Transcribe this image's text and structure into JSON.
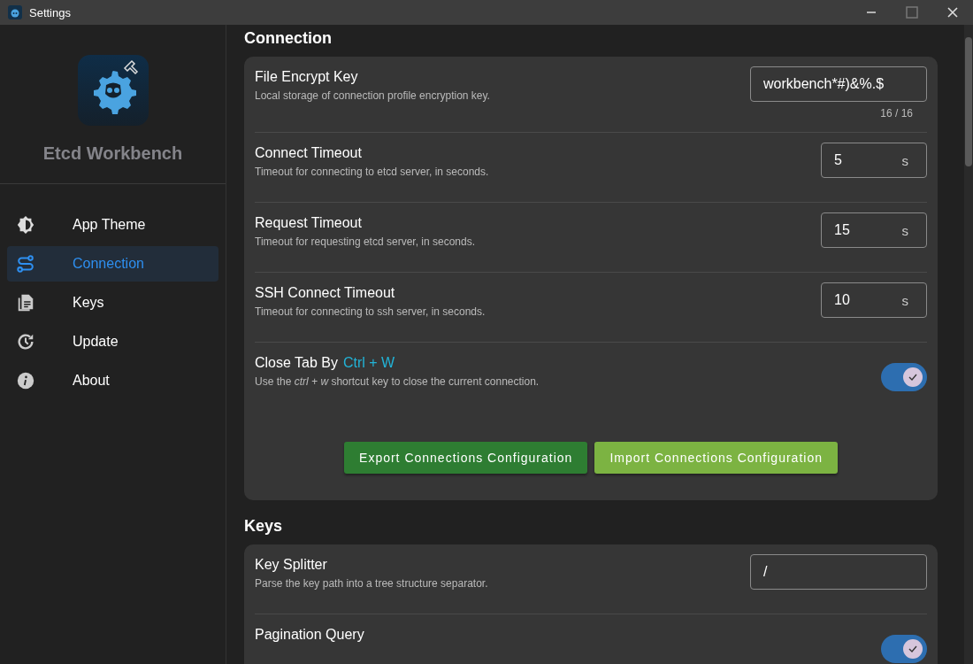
{
  "window": {
    "title": "Settings"
  },
  "app": {
    "name": "Etcd Workbench"
  },
  "sidebar": {
    "items": [
      {
        "kind": "theme",
        "label": "App Theme",
        "selected": false
      },
      {
        "kind": "connection",
        "label": "Connection",
        "selected": true
      },
      {
        "kind": "keys",
        "label": "Keys",
        "selected": false
      },
      {
        "kind": "update",
        "label": "Update",
        "selected": false
      },
      {
        "kind": "about",
        "label": "About",
        "selected": false
      }
    ]
  },
  "sections": [
    {
      "title": "Connection",
      "rows": [
        {
          "kind": "text",
          "label": "File Encrypt Key",
          "description": "Local storage of connection profile encryption key.",
          "value": "workbench*#)&%.$",
          "counter": "16 / 16"
        },
        {
          "kind": "number",
          "label": "Connect Timeout",
          "description": "Timeout for connecting to etcd server, in seconds.",
          "value": "5",
          "unit": "s"
        },
        {
          "kind": "number",
          "label": "Request Timeout",
          "description": "Timeout for requesting etcd server, in seconds.",
          "value": "15",
          "unit": "s"
        },
        {
          "kind": "number",
          "label": "SSH Connect Timeout",
          "description": "Timeout for connecting to ssh server, in seconds.",
          "value": "10",
          "unit": "s"
        },
        {
          "kind": "switch",
          "label": "Close Tab By",
          "shortcut": "Ctrl + W",
          "description": "Use the *ctrl + w* shortcut key to close the current connection.",
          "on": true
        }
      ],
      "buttons": [
        {
          "label": "Export Connections Configuration",
          "color": "#2e7d32"
        },
        {
          "label": "Import Connections Configuration",
          "color": "#7cb342"
        }
      ]
    },
    {
      "title": "Keys",
      "rows": [
        {
          "kind": "text",
          "label": "Key Splitter",
          "description": "Parse the key path into a tree structure separator.",
          "value": "/"
        },
        {
          "kind": "switch",
          "label": "Pagination Query",
          "on": true
        }
      ]
    }
  ]
}
